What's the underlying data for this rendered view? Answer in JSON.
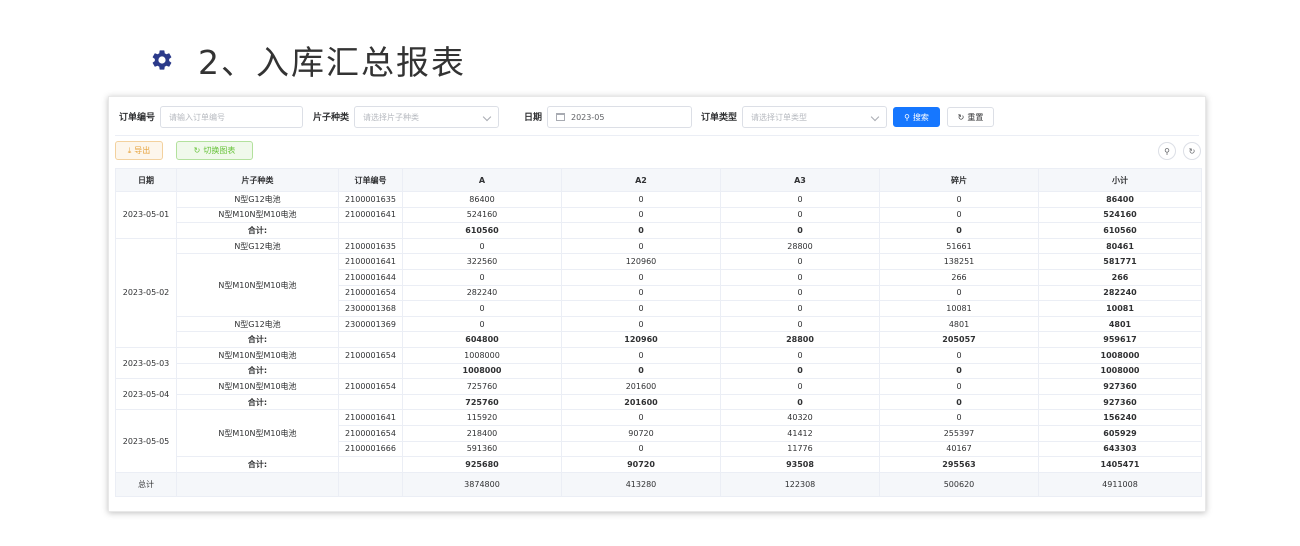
{
  "heading": {
    "title": "2、入库汇总报表"
  },
  "filters": {
    "order_no_label": "订单编号",
    "order_no_placeholder": "请输入订单编号",
    "type_label": "片子种类",
    "type_placeholder": "请选择片子种类",
    "date_label": "日期",
    "date_value": "2023-05",
    "order_type_label": "订单类型",
    "order_type_placeholder": "请选择订单类型",
    "search_label": "搜索",
    "reset_label": "重置"
  },
  "toolbar": {
    "export_label": "导出",
    "switch_label": "切换图表"
  },
  "table": {
    "headers": [
      "日期",
      "片子种类",
      "订单编号",
      "A",
      "A2",
      "A3",
      "碎片",
      "小计"
    ],
    "date_groups": [
      {
        "date": "2023-05-01",
        "rows": [
          {
            "type": "N型G12电池",
            "order": "2100001635",
            "a": "86400",
            "a2": "0",
            "a3": "0",
            "frag": "0",
            "subtotal": "86400"
          },
          {
            "type": "N型M10N型M10电池",
            "order": "2100001641",
            "a": "524160",
            "a2": "0",
            "a3": "0",
            "frag": "0",
            "subtotal": "524160"
          }
        ],
        "sum": {
          "label": "合计:",
          "a": "610560",
          "a2": "0",
          "a3": "0",
          "frag": "0",
          "subtotal": "610560"
        }
      },
      {
        "date": "2023-05-02",
        "rows": [
          {
            "type": "N型G12电池",
            "order": "2100001635",
            "a": "0",
            "a2": "0",
            "a3": "28800",
            "frag": "51661",
            "subtotal": "80461"
          },
          {
            "type": "N型M10N型M10电池",
            "order": "2100001641",
            "a": "322560",
            "a2": "120960",
            "a3": "0",
            "frag": "138251",
            "subtotal": "581771"
          },
          {
            "type": "",
            "order": "2100001644",
            "a": "0",
            "a2": "0",
            "a3": "0",
            "frag": "266",
            "subtotal": "266"
          },
          {
            "type": "",
            "order": "2100001654",
            "a": "282240",
            "a2": "0",
            "a3": "0",
            "frag": "0",
            "subtotal": "282240"
          },
          {
            "type": "",
            "order": "2300001368",
            "a": "0",
            "a2": "0",
            "a3": "0",
            "frag": "10081",
            "subtotal": "10081"
          },
          {
            "type": "N型G12电池",
            "order": "2300001369",
            "a": "0",
            "a2": "0",
            "a3": "0",
            "frag": "4801",
            "subtotal": "4801"
          }
        ],
        "sum": {
          "label": "合计:",
          "a": "604800",
          "a2": "120960",
          "a3": "28800",
          "frag": "205057",
          "subtotal": "959617"
        }
      },
      {
        "date": "2023-05-03",
        "rows": [
          {
            "type": "N型M10N型M10电池",
            "order": "2100001654",
            "a": "1008000",
            "a2": "0",
            "a3": "0",
            "frag": "0",
            "subtotal": "1008000"
          }
        ],
        "sum": {
          "label": "合计:",
          "a": "1008000",
          "a2": "0",
          "a3": "0",
          "frag": "0",
          "subtotal": "1008000"
        }
      },
      {
        "date": "2023-05-04",
        "rows": [
          {
            "type": "N型M10N型M10电池",
            "order": "2100001654",
            "a": "725760",
            "a2": "201600",
            "a3": "0",
            "frag": "0",
            "subtotal": "927360"
          }
        ],
        "sum": {
          "label": "合计:",
          "a": "725760",
          "a2": "201600",
          "a3": "0",
          "frag": "0",
          "subtotal": "927360"
        }
      },
      {
        "date": "2023-05-05",
        "rows": [
          {
            "type": "N型M10N型M10电池",
            "order": "2100001641",
            "a": "115920",
            "a2": "0",
            "a3": "40320",
            "frag": "0",
            "subtotal": "156240"
          },
          {
            "type": "",
            "order": "2100001654",
            "a": "218400",
            "a2": "90720",
            "a3": "41412",
            "frag": "255397",
            "subtotal": "605929"
          },
          {
            "type": "",
            "order": "2100001666",
            "a": "591360",
            "a2": "0",
            "a3": "11776",
            "frag": "40167",
            "subtotal": "643303"
          }
        ],
        "sum": {
          "label": "合计:",
          "a": "925680",
          "a2": "90720",
          "a3": "93508",
          "frag": "295563",
          "subtotal": "1405471"
        }
      }
    ],
    "total": {
      "label": "总计",
      "a": "3874800",
      "a2": "413280",
      "a3": "122308",
      "frag": "500620",
      "subtotal": "4911008"
    }
  }
}
